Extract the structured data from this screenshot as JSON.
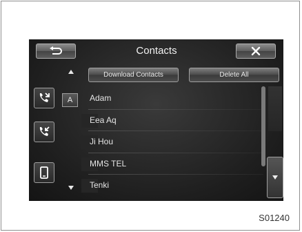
{
  "header": {
    "title": "Contacts"
  },
  "actions": {
    "download_label": "Download Contacts",
    "delete_all_label": "Delete All"
  },
  "index": {
    "current_letter": "A"
  },
  "contacts": [
    {
      "name": "Adam"
    },
    {
      "name": "Eea Aq"
    },
    {
      "name": "Ji Hou"
    },
    {
      "name": "MMS TEL"
    },
    {
      "name": "Tenki"
    }
  ],
  "figure_code": "S01240",
  "icons": {
    "back": "back-arrow-icon",
    "close": "close-icon",
    "side": [
      "outgoing-call-history-icon",
      "incoming-call-history-icon",
      "phone-device-icon"
    ]
  },
  "colors": {
    "screen_bg": "#1e1e1e",
    "text": "#e6e6e6"
  }
}
